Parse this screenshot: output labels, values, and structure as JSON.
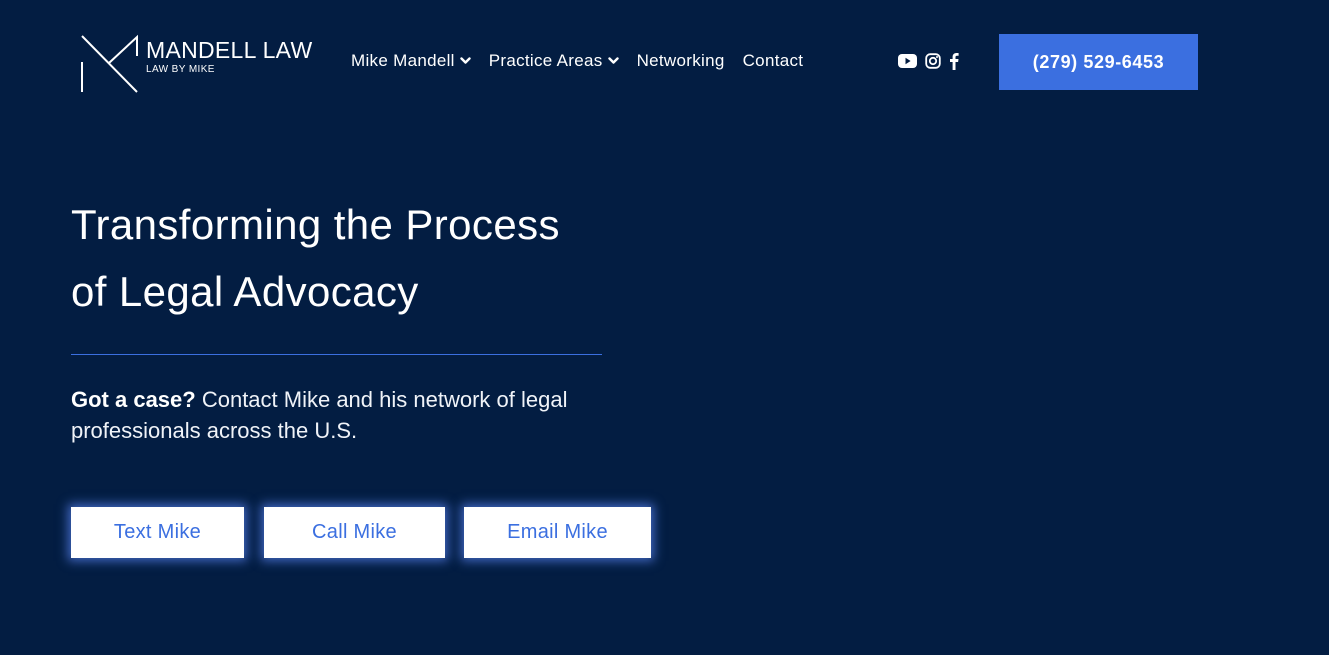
{
  "header": {
    "logo": {
      "name": "MANDELL LAW",
      "tagline": "LAW BY MIKE"
    },
    "nav": [
      {
        "label": "Mike Mandell",
        "has_dropdown": true
      },
      {
        "label": "Practice Areas",
        "has_dropdown": true
      },
      {
        "label": "Networking",
        "has_dropdown": false
      },
      {
        "label": "Contact",
        "has_dropdown": false
      }
    ],
    "social_icons": [
      "youtube-icon",
      "instagram-icon",
      "facebook-icon"
    ],
    "phone_button": "(279) 529-6453"
  },
  "hero": {
    "title_line1": "Transforming the Process",
    "title_line2": "of Legal Advocacy",
    "intro_bold": "Got a case?",
    "intro_text": " Contact Mike and his network of legal professionals across the U.S.",
    "buttons": {
      "text": "Text Mike",
      "call": "Call Mike",
      "email": "Email Mike"
    }
  },
  "colors": {
    "background": "#031d42",
    "accent": "#3b6fe0",
    "text": "#ffffff"
  }
}
